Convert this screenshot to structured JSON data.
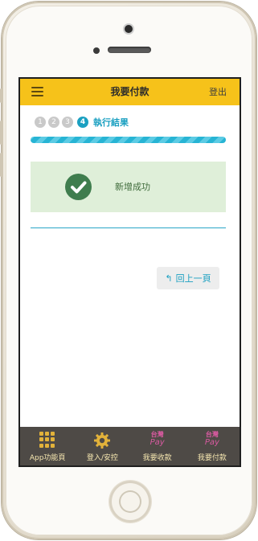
{
  "header": {
    "title": "我要付款",
    "logout_label": "登出"
  },
  "steps": {
    "items": [
      "1",
      "2",
      "3"
    ],
    "active_number": "4",
    "active_label": "執行結果"
  },
  "result": {
    "message": "新增成功",
    "status_color": "#3f7d4e"
  },
  "back_button": {
    "icon": "↰",
    "label": "回上一頁"
  },
  "tabbar": {
    "items": [
      {
        "label": "App功能頁",
        "icon": "grid-icon"
      },
      {
        "label": "登入/安控",
        "icon": "gear-icon"
      },
      {
        "label": "我要收款",
        "icon": "taiwan-pay-icon",
        "logo_line1": "台灣",
        "logo_line2": "Pay"
      },
      {
        "label": "我要付款",
        "icon": "taiwan-pay-icon",
        "logo_line1": "台灣",
        "logo_line2": "Pay"
      }
    ]
  },
  "colors": {
    "header_bg": "#f6c21a",
    "accent": "#1ba0c1",
    "success_bg": "#dfefd9",
    "tabbar_bg": "#4e4a46"
  }
}
